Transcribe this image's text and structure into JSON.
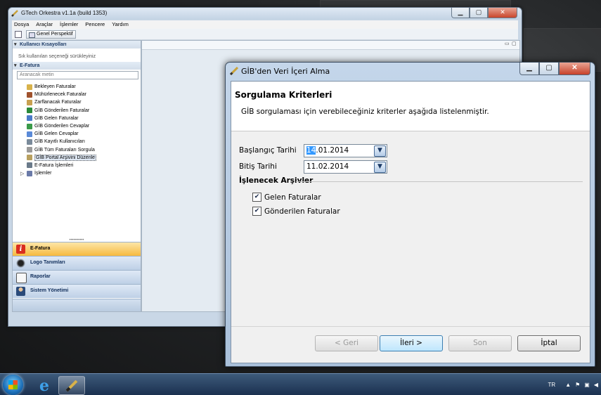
{
  "main_window": {
    "title": "GTech Orkestra v1.1a (build 1353)",
    "menu": [
      "Dosya",
      "Araçlar",
      "İşlemler",
      "Pencere",
      "Yardım"
    ],
    "perspective_button": "Genel Perspektif"
  },
  "left_panel": {
    "shortcuts_header": "Kullanıcı Kısayolları",
    "shortcuts_hint": "Sık kullanılan seçeneği sürükleyiniz",
    "efatura_header": "E-Fatura",
    "search_placeholder": "Aranacak metin",
    "tree_items": [
      {
        "label": "Bekleyen Faturalar",
        "color": "#d8b24a"
      },
      {
        "label": "Mühürlenecek Faturalar",
        "color": "#a0522d"
      },
      {
        "label": "Zarflanacak Faturalar",
        "color": "#c8a050"
      },
      {
        "label": "GİB Gönderilen Faturalar",
        "color": "#2a8a3a"
      },
      {
        "label": "GİB Gelen Faturalar",
        "color": "#4a7ac8"
      },
      {
        "label": "GİB Gönderilen Cevaplar",
        "color": "#3a9a4a"
      },
      {
        "label": "GİB Gelen Cevaplar",
        "color": "#5a8ad8"
      },
      {
        "label": "GİB Kayıtlı Kullanıcıları",
        "color": "#7a8a9a"
      },
      {
        "label": "GİB Tüm Faturaları Sorgula",
        "color": "#9a9a9a"
      },
      {
        "label": "GİB Portal Arşivini Düzenle",
        "color": "#b8a060"
      },
      {
        "label": "E-Fatura İşlemleri",
        "color": "#6a7a8a"
      },
      {
        "label": "İşlemler",
        "color": "#6a7aa8"
      }
    ],
    "nav_buttons": [
      {
        "label": "E-Fatura",
        "icon": "efatura-icon",
        "active": true
      },
      {
        "label": "Logo Tanımları",
        "icon": "logo-icon",
        "active": false
      },
      {
        "label": "Raporlar",
        "icon": "report-icon",
        "active": false
      },
      {
        "label": "Sistem Yönetimi",
        "icon": "user-admin-icon",
        "active": false
      }
    ]
  },
  "dialog": {
    "title": "GİB'den Veri İçeri Alma",
    "banner_title": "Sorgulama Kriterleri",
    "banner_desc": "GİB sorgulaması için verebileceğiniz kriterler aşağıda listelenmiştir.",
    "start_label": "Başlangıç Tarihi",
    "start_value_selected": "14",
    "start_value_rest": ".01.2014",
    "end_label": "Bitiş Tarihi",
    "end_value": "11.02.2014",
    "archives_header": "İşlenecek Arşivler",
    "checkboxes": [
      {
        "label": "Gelen Faturalar",
        "checked": true
      },
      {
        "label": "Gönderilen Faturalar",
        "checked": true
      }
    ],
    "buttons": {
      "back": "< Geri",
      "next": "İleri >",
      "finish": "Son",
      "cancel": "İptal"
    }
  },
  "taskbar": {
    "language": "TR"
  }
}
